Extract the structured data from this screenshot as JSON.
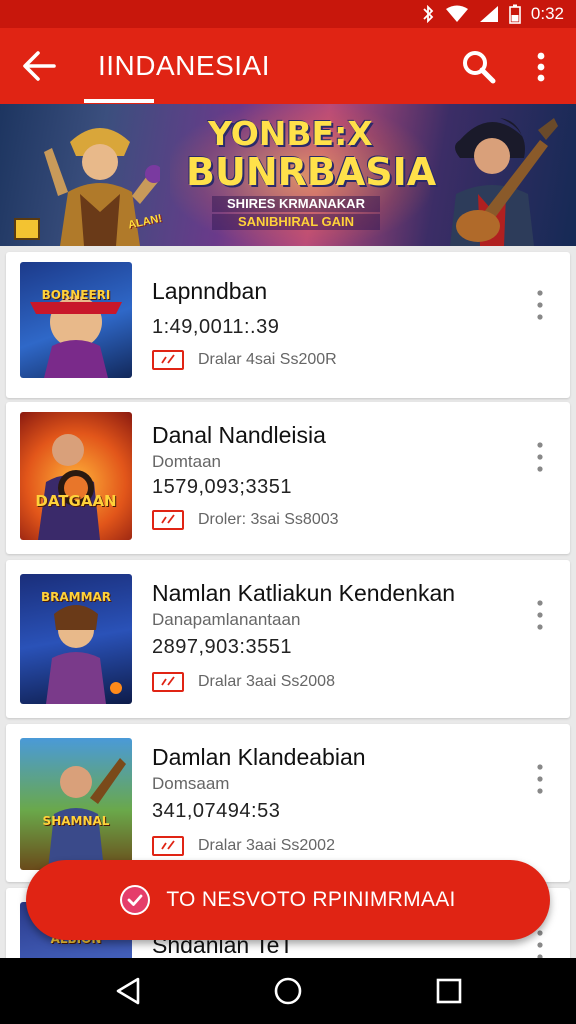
{
  "status_bar": {
    "time": "0:32"
  },
  "app_bar": {
    "title": "IINDANESIAI"
  },
  "banner": {
    "headline_1": "YONBE:X",
    "headline_2": "BUNRBASIA",
    "subtitle_1": "SHIRES KRMANAKAR",
    "subtitle_2": "SANIBHIRAL GAIN"
  },
  "items": [
    {
      "name": "Lapnndban",
      "subtitle": "",
      "number": "1:49,0011:.39",
      "meta": "Dralar 4sai Ss200R",
      "thumb_title": "BORNEERI"
    },
    {
      "name": "Danal Nandleisia",
      "subtitle": "Domtaan",
      "number": "1579,093;3351",
      "meta": "Droler: 3sai Ss8003",
      "thumb_title": "DATGAAN"
    },
    {
      "name": "Namlan Katliakun Kendenkan",
      "subtitle": "Danapamlanantaan",
      "number": "2897,903:3551",
      "meta": "Dralar 3aai Ss2008",
      "thumb_title": "BRAMMAR"
    },
    {
      "name": "Damlan Klandeabian",
      "subtitle": "Domsaam",
      "number": "341,07494:53",
      "meta": "Dralar 3aai Ss2002",
      "thumb_title": "SHAMNAL"
    },
    {
      "name": "Shdanlan TeT",
      "subtitle": "",
      "number": "",
      "meta": "",
      "thumb_title": "ALBION"
    }
  ],
  "cta": {
    "label": "TO NESVOTO RPINIMRMAAI"
  },
  "colors": {
    "primary": "#e02414",
    "status_bar": "#c8170c",
    "nav_bar": "#000000"
  },
  "icons": [
    "back-arrow-icon",
    "search-icon",
    "more-vert-icon",
    "bluetooth-icon",
    "wifi-icon",
    "signal-icon",
    "battery-icon",
    "check-circle-icon",
    "nav-back-icon",
    "nav-home-icon",
    "nav-recents-icon"
  ]
}
